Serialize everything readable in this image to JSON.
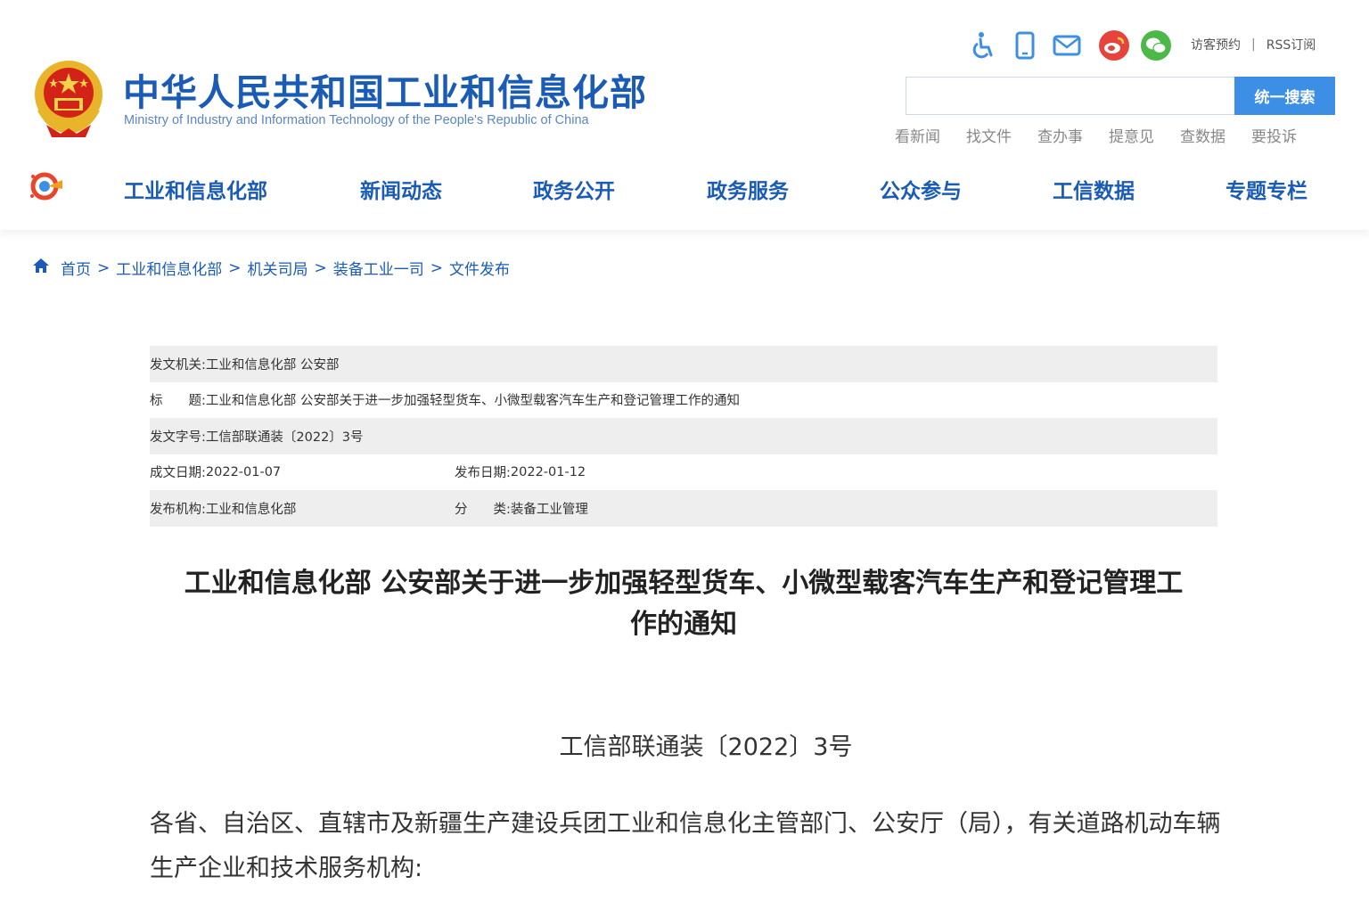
{
  "header": {
    "site_title": "中华人民共和国工业和信息化部",
    "site_subtitle": "Ministry of Industry and Information Technology of the People's Republic of China",
    "top_icons": [
      "accessibility-icon",
      "mobile-icon",
      "mail-icon",
      "weibo-icon",
      "wechat-icon"
    ],
    "visitor_appointment": "访客预约",
    "separator": "|",
    "rss": "RSS订阅",
    "search": {
      "placeholder": "",
      "button_label": "统一搜索"
    },
    "quick_links": [
      "看新闻",
      "找文件",
      "查办事",
      "提意见",
      "查数据",
      "要投诉"
    ]
  },
  "nav": {
    "items": [
      "工业和信息化部",
      "新闻动态",
      "政务公开",
      "政务服务",
      "公众参与",
      "工信数据",
      "专题专栏"
    ]
  },
  "breadcrumb": {
    "items": [
      "首页",
      "工业和信息化部",
      "机关司局",
      "装备工业一司",
      "文件发布"
    ],
    "separator": ">"
  },
  "meta": {
    "issuer_label": "发文机关:",
    "issuer": "工业和信息化部 公安部",
    "title_label": "标　　题:",
    "title": "工业和信息化部 公安部关于进一步加强轻型货车、小微型载客汽车生产和登记管理工作的通知",
    "doc_no_label": "发文字号:",
    "doc_no": "工信部联通装〔2022〕3号",
    "written_date_label": "成文日期:",
    "written_date": "2022-01-07",
    "publish_date_label": "发布日期:",
    "publish_date": "2022-01-12",
    "publisher_label": "发布机构:",
    "publisher": "工业和信息化部",
    "category_label": "分　　类:",
    "category": "装备工业管理"
  },
  "article": {
    "title_line1": "工业和信息化部 公安部关于进一步加强轻型货车、小微型载客汽车生产和登记管理工",
    "title_line2": "作的通知",
    "doc_number": "工信部联通装〔2022〕3号",
    "salutation": "各省、自治区、直辖市及新疆生产建设兵团工业和信息化主管部门、公安厅（局），有关道路机动车辆生产企业和技术服务机构:"
  },
  "colors": {
    "brand_blue": "#1a5bb5",
    "search_button": "#3d8fe6",
    "meta_row_grey": "#eeeeee"
  }
}
